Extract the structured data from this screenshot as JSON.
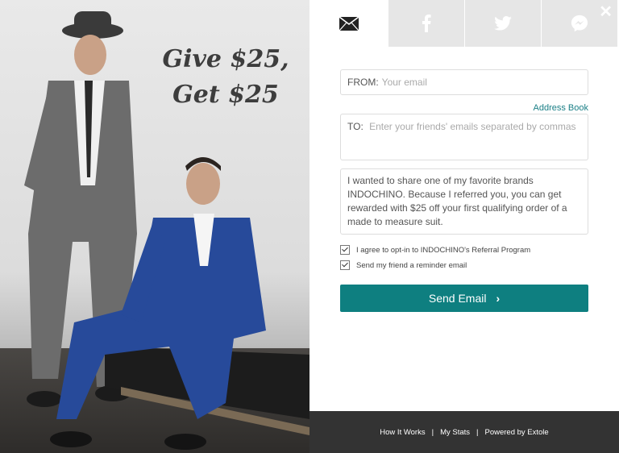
{
  "promo": {
    "line1": "Give $25,",
    "line2": "Get $25"
  },
  "tabs": [
    {
      "icon": "envelope-icon",
      "active": true
    },
    {
      "icon": "facebook-icon",
      "active": false
    },
    {
      "icon": "twitter-icon",
      "active": false
    },
    {
      "icon": "messenger-icon",
      "active": false
    }
  ],
  "close": {
    "glyph": "✕"
  },
  "form": {
    "from_label": "FROM:",
    "from_placeholder": "Your email",
    "address_book": "Address Book",
    "to_label": "TO:",
    "to_placeholder": "Enter your friends' emails separated by commas",
    "message": "I wanted to share one of my favorite brands INDOCHINO. Because I referred you, you can get rewarded with $25 off your first qualifying order of a made to measure suit.",
    "opt_in_label": "I agree to opt-in to INDOCHINO's Referral Program",
    "reminder_label": "Send my friend a reminder email",
    "send_label": "Send Email",
    "send_chevron": "›"
  },
  "footer": {
    "how": "How It Works",
    "stats": "My Stats",
    "powered": "Powered by Extole",
    "separator": "|"
  },
  "colors": {
    "accent": "#0e7f80",
    "link": "#1a7f86",
    "footer_bg": "#333333",
    "tab_inactive": "#e6e6e6"
  }
}
